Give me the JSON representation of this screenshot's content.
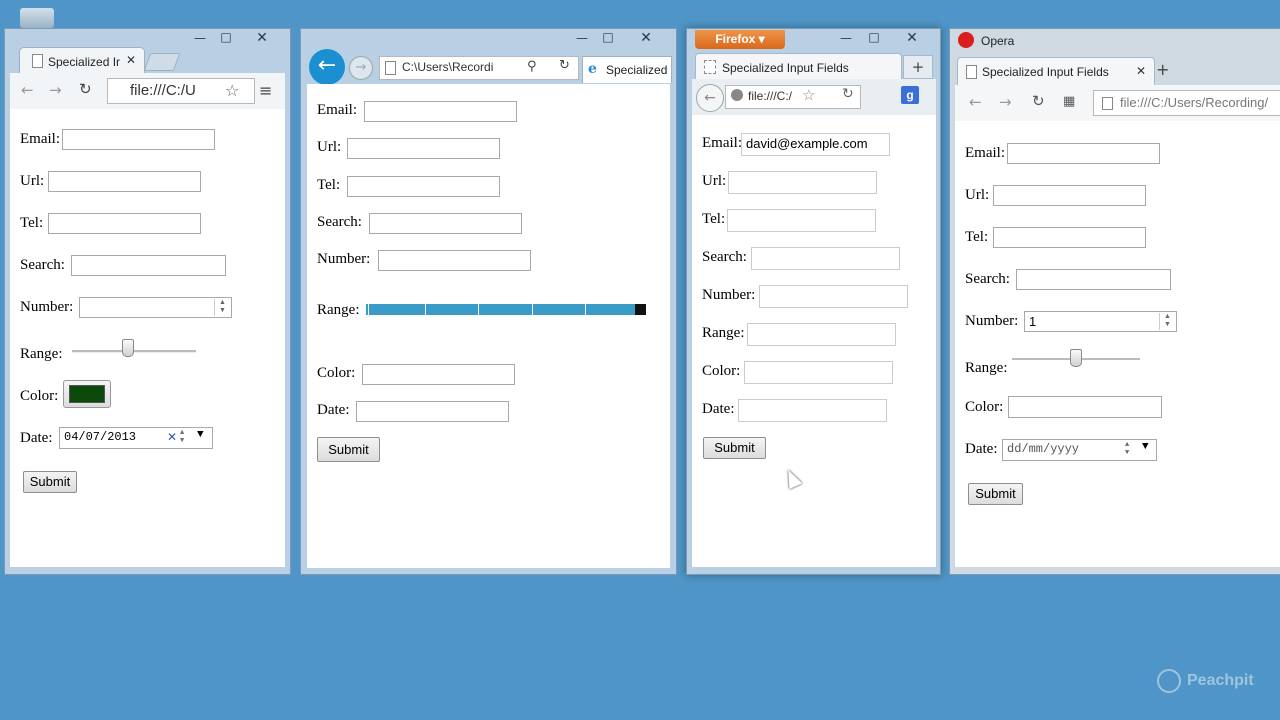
{
  "page_title": "Specialized Input Fields",
  "colors": {
    "desktop": "#4f95c7",
    "accent_firefox": "#e57a1f",
    "range_ie": "#3a9bc7",
    "color_swatch": "#0b4a0b"
  },
  "labels": {
    "email": "Email:",
    "url": "Url:",
    "tel": "Tel:",
    "search": "Search:",
    "number": "Number:",
    "range": "Range:",
    "color": "Color:",
    "date": "Date:",
    "submit": "Submit"
  },
  "chrome": {
    "tab_title": "Specialized Ir",
    "address": "file:///C:/U",
    "date_value": "04/07/2013"
  },
  "ie": {
    "address": "C:\\Users\\Recordi",
    "tab_title": "Specialized I"
  },
  "firefox": {
    "app_button": "Firefox",
    "tab_title": "Specialized Input Fields",
    "address": "file:///C:/",
    "email_value": "david@example.com"
  },
  "opera": {
    "app_name": "Opera",
    "tab_title": "Specialized Input Fields",
    "address": "file:///C:/Users/Recording/",
    "number_value": "1",
    "date_placeholder": "dd/mm/yyyy"
  },
  "watermark": "Peachpit"
}
